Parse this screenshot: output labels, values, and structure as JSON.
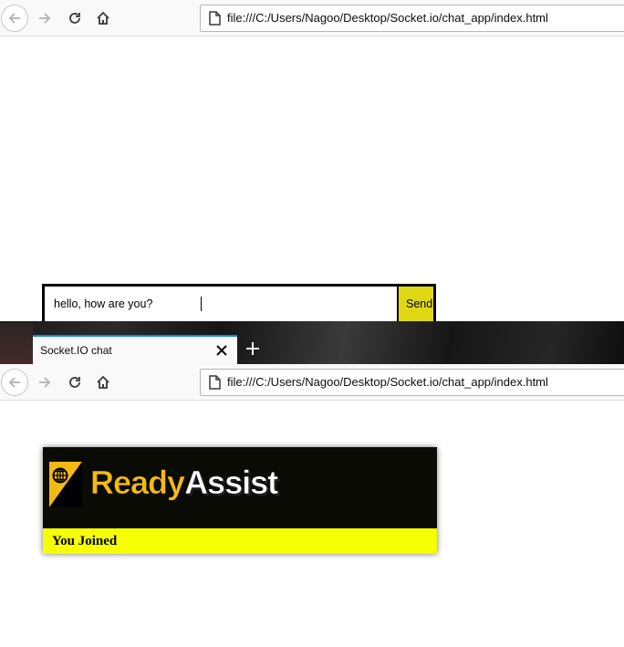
{
  "top_window": {
    "url": "file:///C:/Users/Nagoo/Desktop/Socket.io/chat_app/index.html",
    "chat_form": {
      "input_value": "hello, how are you?",
      "send_label": "Send"
    }
  },
  "bottom_window": {
    "tab": {
      "title": "Socket.IO chat"
    },
    "url": "file:///C:/Users/Nagoo/Desktop/Socket.io/chat_app/index.html",
    "page": {
      "logo": {
        "part1": "Ready",
        "part2": "Assist",
        "icon": "globe-icon"
      },
      "status_message": "You Joined"
    }
  },
  "icons": {
    "back": "back-arrow-icon",
    "forward": "forward-arrow-icon",
    "reload": "reload-icon",
    "home": "home-icon",
    "page": "page-icon",
    "close": "close-icon",
    "new_tab": "plus-icon"
  },
  "colors": {
    "send_button": "#e0d713",
    "status_bar": "#f5ff00",
    "logo_background": "#0b0b06",
    "logo_ready": "#f2bb12",
    "logo_assist": "#ffffff",
    "tab_accent": "#0a84ff"
  }
}
